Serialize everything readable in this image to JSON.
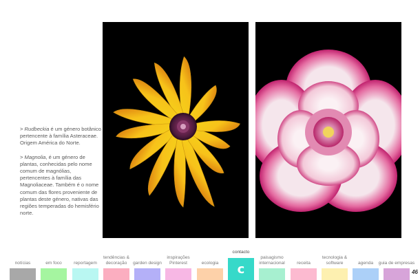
{
  "captions": {
    "rudbeckia": {
      "prefix": "> ",
      "name": "Rudbeckia",
      "text": " é um género botânico pertencente à família Asteraceae. Origem América do Norte."
    },
    "magnolia": {
      "prefix": "> ",
      "name": "Magnolia",
      "text": ", é um género de plantas, conhecidas pelo nome comum de magnólias, pertencentes à família das Magnoliaceae. Também é o nome comum das flores proveniente de plantas deste género, nativas das regiões temperadas do hemisfério norte."
    }
  },
  "nav": {
    "items": [
      {
        "label": "notícias",
        "color": "#a8a8a8"
      },
      {
        "label": "em foco",
        "color": "#a5f5a0"
      },
      {
        "label": "reportagem",
        "color": "#b9f7f2"
      },
      {
        "label": "tendências & decoração",
        "color": "#fbaec0"
      },
      {
        "label": "garden design",
        "color": "#b4b0f8"
      },
      {
        "label": "inspirações Pinterest",
        "color": "#f7b7e4"
      },
      {
        "label": "ecologia",
        "color": "#fdd1a9"
      },
      {
        "label": "contacto",
        "color": "#36d9c9",
        "letter": "c",
        "active": true
      },
      {
        "label": "paisagismo internacional",
        "color": "#a7f0d0"
      },
      {
        "label": "receita",
        "color": "#fcbad0"
      },
      {
        "label": "tecnologia & software",
        "color": "#fdf0b0"
      },
      {
        "label": "agenda",
        "color": "#acd0f8"
      },
      {
        "label": "guia de empresas",
        "color": "#d7a4d9"
      }
    ]
  },
  "page_number": "46"
}
